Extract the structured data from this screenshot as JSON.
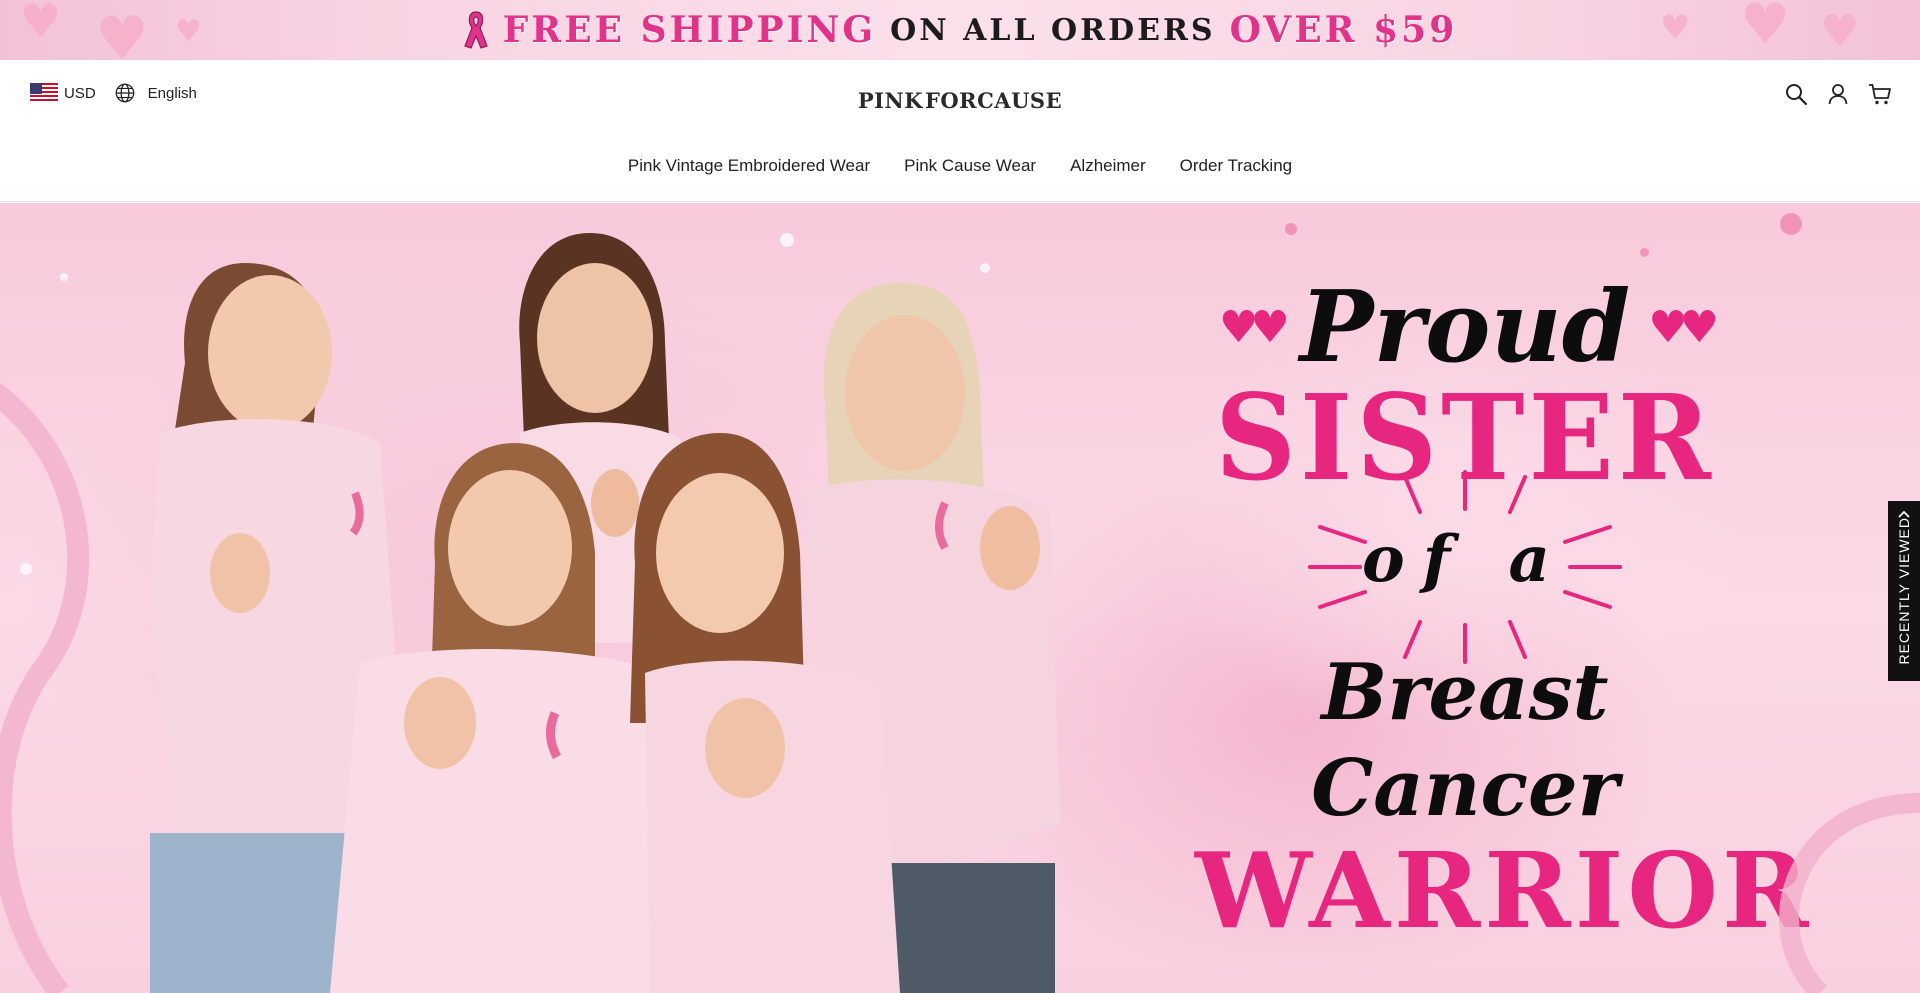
{
  "announcement": {
    "part1": "FREE SHIPPING",
    "part2": "ON ALL ORDERS",
    "part3": "OVER $59",
    "icon": "ribbon-icon"
  },
  "header": {
    "currency": "USD",
    "language": "English",
    "logo_left": "PINK",
    "logo_right": "FORCAUSE",
    "icons": [
      "search-icon",
      "account-icon",
      "cart-icon"
    ]
  },
  "nav": {
    "items": [
      {
        "label": "Pink Vintage Embroidered Wear"
      },
      {
        "label": "Pink Cause Wear"
      },
      {
        "label": "Alzheimer"
      },
      {
        "label": "Order Tracking"
      }
    ]
  },
  "hero": {
    "line1": "Proud",
    "line2": "SISTER",
    "line3": "of a",
    "line4": "Breast Cancer",
    "line5": "WARRIOR"
  },
  "recently_viewed": {
    "label": "RECENTLY VIEWED"
  },
  "colors": {
    "brand_pink": "#e7267f",
    "announcement_bg": "#f8d4e3",
    "hero_bg": "#f8cadb"
  }
}
